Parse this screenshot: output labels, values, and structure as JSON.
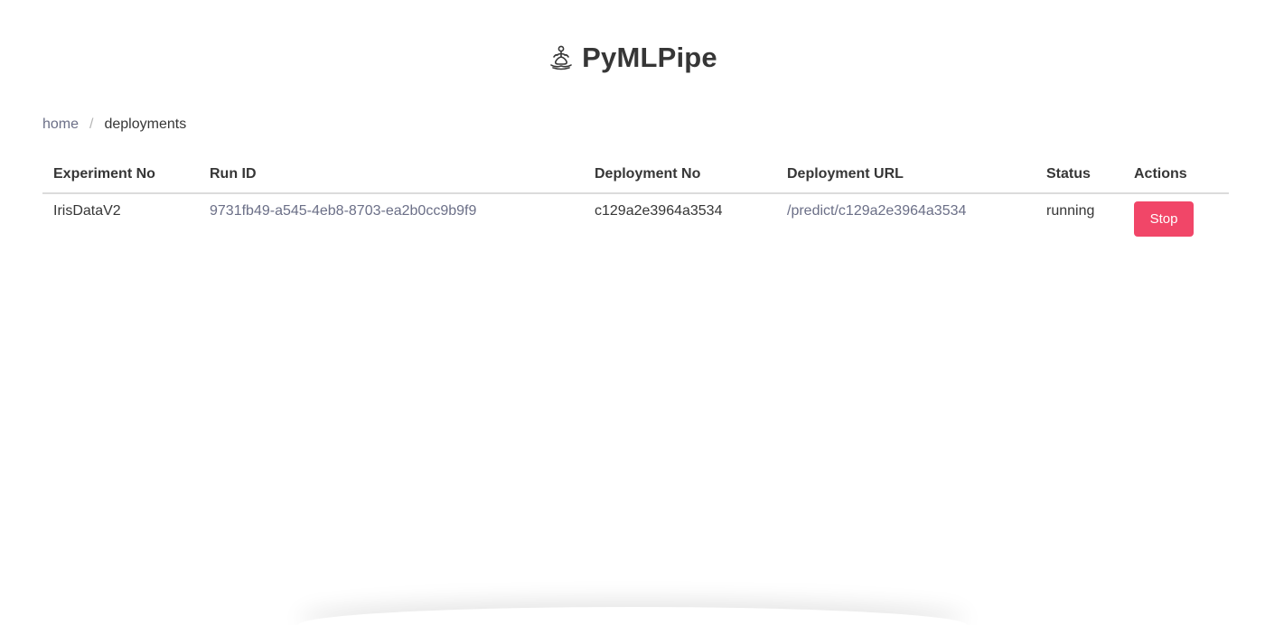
{
  "app": {
    "title": "PyMLPipe",
    "logo_icon": "meditation-icon"
  },
  "breadcrumb": {
    "home_label": "home",
    "separator": "/",
    "current_label": "deployments"
  },
  "table": {
    "headers": {
      "experiment_no": "Experiment No",
      "run_id": "Run ID",
      "deployment_no": "Deployment No",
      "deployment_url": "Deployment URL",
      "status": "Status",
      "actions": "Actions"
    },
    "rows": [
      {
        "experiment_no": "IrisDataV2",
        "run_id": "9731fb49-a545-4eb8-8703-ea2b0cc9b9f9",
        "deployment_no": "c129a2e3964a3534",
        "deployment_url": "/predict/c129a2e3964a3534",
        "status": "running",
        "action_label": "Stop"
      }
    ]
  },
  "colors": {
    "link": "#6b6f87",
    "danger": "#f14668",
    "text": "#363636"
  }
}
